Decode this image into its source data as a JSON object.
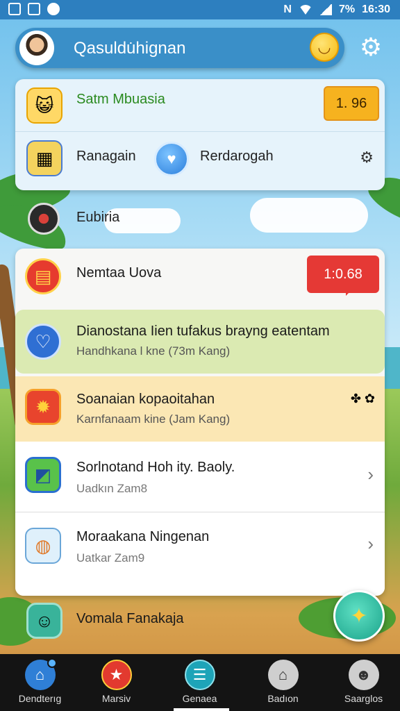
{
  "status_bar": {
    "time": "16:30",
    "battery": "7%"
  },
  "header": {
    "title": "Qasuldu̇hignan",
    "avatar_icon": "user-avatar",
    "emoji_icon": "smiley-face-icon",
    "settings_icon": "gear-icon"
  },
  "top_panel": {
    "row1": {
      "label": "Satm Mbuasia",
      "badge": "1. 96",
      "icon": "cat-face-icon"
    },
    "row2": {
      "label_left": "Ranagain",
      "label_right": "Rerdarogah",
      "left_icon": "box-stack-icon",
      "center_icon": "heart-chat-icon",
      "right_icon": "small-gear-icon"
    }
  },
  "strip": {
    "label": "Eubiria",
    "icon": "shield-disc-icon"
  },
  "list": {
    "rows": [
      {
        "title": "Nemtaa Uova",
        "badge": "1:0.68",
        "icon": "note-square-icon"
      },
      {
        "title": "Dianostana Iien tufakus brayng eatentam",
        "subtitle": "Handhkana l kne (73m Kang)",
        "icon": "heart-circle-icon"
      },
      {
        "title": "Soanaian kopaoitahan",
        "subtitle": "Karnfanaam kine (Jam Kang)",
        "icon": "gear-badge-icon"
      },
      {
        "title": "Sorlnotand Hoh ity. Baoly.",
        "subtitle": "Uadkın Zam8",
        "icon": "green-cube-icon"
      },
      {
        "title": "Moraakana Ningenan",
        "subtitle": "Uatkar Zam9",
        "icon": "blue-box-icon"
      }
    ]
  },
  "last_row": {
    "label": "Vomala Fanakaja",
    "icon": "character-avatar"
  },
  "fab": {
    "icon": "robot-chick-icon"
  },
  "bottom_nav": [
    {
      "label": "Dendterıg",
      "icon": "home-icon"
    },
    {
      "label": "Marsiv",
      "icon": "star-icon"
    },
    {
      "label": "Genaea",
      "icon": "chat-lines-icon"
    },
    {
      "label": "Badıon",
      "icon": "house-outline-icon"
    },
    {
      "label": "Saarglos",
      "icon": "profile-icon"
    }
  ],
  "colors": {
    "accent": "#3a8fc8",
    "badge_red": "#e53935",
    "badge_orange": "#f6b21f"
  }
}
